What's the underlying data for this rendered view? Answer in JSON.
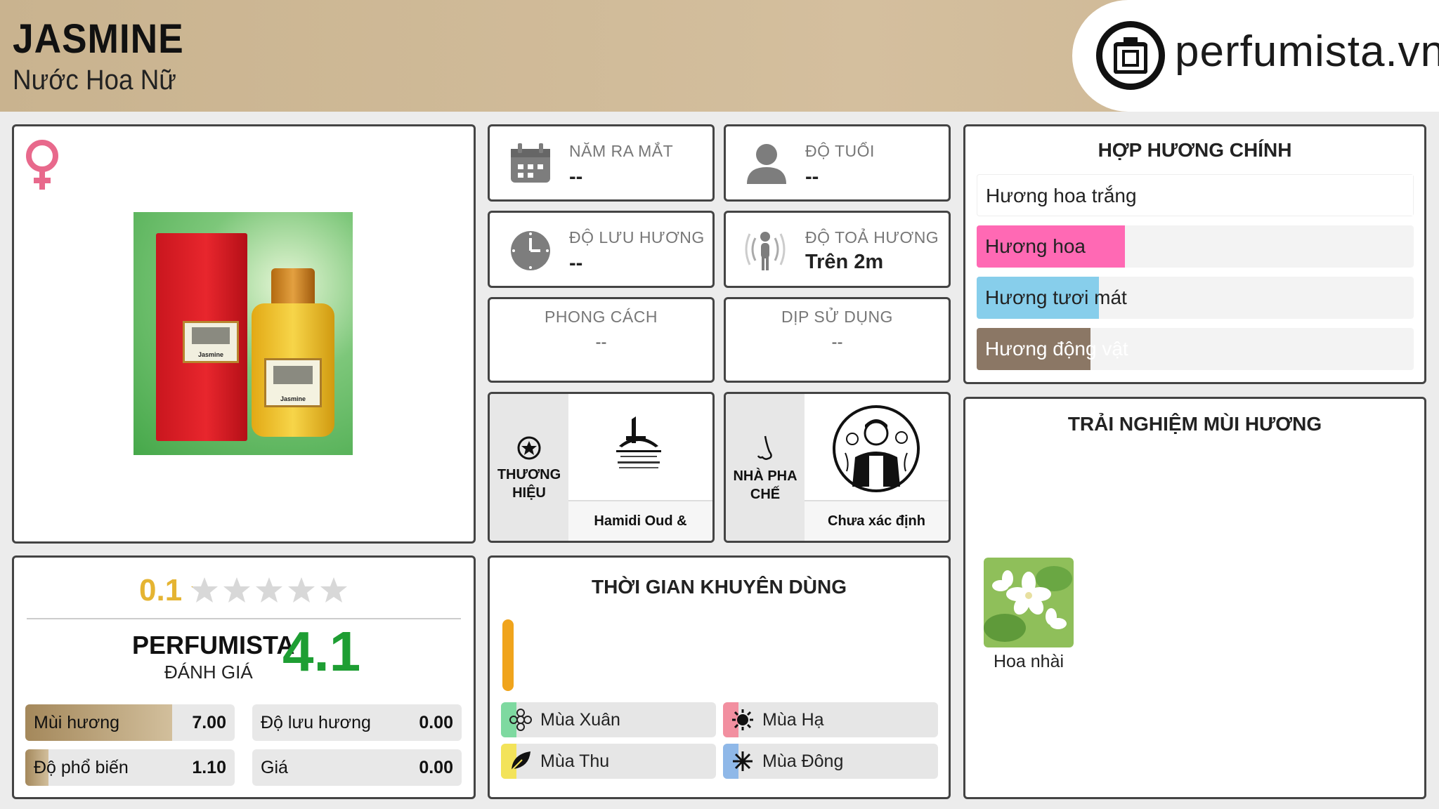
{
  "header": {
    "title": "JASMINE",
    "subtitle": "Nước Hoa Nữ",
    "logo_text": "perfumista.vn"
  },
  "product": {
    "gender_icon": "female-symbol-icon",
    "box_label_text": "Jasmine",
    "bottle_label_text": "Jasmine"
  },
  "info": {
    "launch_year": {
      "label": "NĂM RA MẮT",
      "value": "--"
    },
    "age": {
      "label": "ĐỘ TUỔI",
      "value": "--"
    },
    "longevity": {
      "label": "ĐỘ LƯU HƯƠNG",
      "value": "--"
    },
    "sillage": {
      "label": "ĐỘ TOẢ HƯƠNG",
      "value": "Trên 2m"
    },
    "style": {
      "label": "PHONG CÁCH",
      "value": "--"
    },
    "occasion": {
      "label": "DỊP SỬ DỤNG",
      "value": "--"
    }
  },
  "brand": {
    "caption_line1": "THƯƠNG",
    "caption_line2": "HIỆU",
    "name": "Hamidi Oud & Perfumes"
  },
  "perfumer": {
    "caption_line1": "NHÀ PHA",
    "caption_line2": "CHẾ",
    "name": "Chưa xác định"
  },
  "accords": {
    "title": "HỢP HƯƠNG CHÍNH",
    "items": [
      {
        "label": "Hương hoa trắng",
        "strength": 1.0,
        "color": "#ffffff"
      },
      {
        "label": "Hương hoa",
        "strength": 0.34,
        "color": "#ff69b4"
      },
      {
        "label": "Hương tươi mát",
        "strength": 0.28,
        "color": "#87ceeb"
      },
      {
        "label": "Hương động vật",
        "strength": 0.26,
        "color": "#8b7765"
      }
    ]
  },
  "rating": {
    "user_score": "0.1",
    "stars_filled": 0.02,
    "brand_line1": "PERFUMISTA",
    "brand_line2": "ĐÁNH GIÁ",
    "score": "4.1",
    "stats": [
      {
        "label": "Mùi hương",
        "value": "7.00",
        "fill": 0.7
      },
      {
        "label": "Độ lưu hương",
        "value": "0.00",
        "fill": 0.0
      },
      {
        "label": "Độ phổ biến",
        "value": "1.10",
        "fill": 0.11
      },
      {
        "label": "Giá",
        "value": "0.00",
        "fill": 0.0
      }
    ]
  },
  "usage": {
    "title": "THỜI GIAN KHUYÊN DÙNG",
    "seasons": [
      {
        "label": "Mùa Xuân",
        "color": "#7ed9a0",
        "icon": "flower-icon"
      },
      {
        "label": "Mùa Hạ",
        "color": "#f28fa0",
        "icon": "sun-icon"
      },
      {
        "label": "Mùa Thu",
        "color": "#f3e35a",
        "icon": "leaf-icon"
      },
      {
        "label": "Mùa Đông",
        "color": "#8fb8e8",
        "icon": "snowflake-icon"
      }
    ]
  },
  "experience": {
    "title": "TRẢI NGHIỆM MÙI HƯƠNG",
    "notes": [
      {
        "label": "Hoa nhài"
      }
    ]
  }
}
